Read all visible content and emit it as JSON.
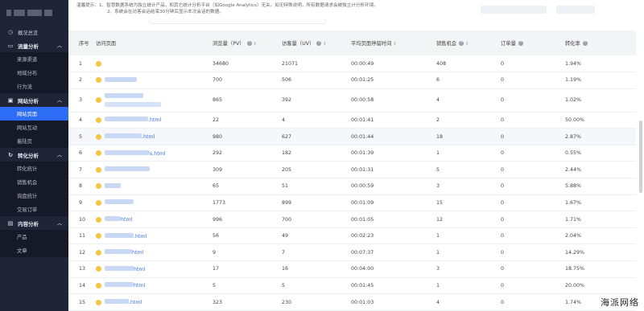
{
  "header": {
    "notice_line1": "温馨提示：1、智慧数据系统为独立统计产品，和其它统计分析平台（如Google Analytics）无关。如无特殊说明，所有数据请求会被独立计分析环境。",
    "notice_line2": "2、系统会在访客会话结束30分钟后显示本次会话的数据。"
  },
  "sidebar": {
    "items": [
      {
        "type": "item",
        "label": "概况总览",
        "icon": "dashboard-icon",
        "glyph": "◷"
      },
      {
        "type": "group",
        "label": "流量分析",
        "icon": "traffic-icon",
        "glyph": "▭"
      },
      {
        "type": "sub",
        "label": "来源渠道"
      },
      {
        "type": "sub",
        "label": "地域分布"
      },
      {
        "type": "sub",
        "label": "行为流"
      },
      {
        "type": "group",
        "label": "网站分析",
        "icon": "website-icon",
        "glyph": "▣"
      },
      {
        "type": "sub",
        "label": "网站页面",
        "active": true
      },
      {
        "type": "sub",
        "label": "网站互动"
      },
      {
        "type": "sub",
        "label": "着陆页"
      },
      {
        "type": "group",
        "label": "转化分析",
        "icon": "conversion-icon",
        "glyph": "↻"
      },
      {
        "type": "sub",
        "label": "转化统计"
      },
      {
        "type": "sub",
        "label": "销售机会"
      },
      {
        "type": "sub",
        "label": "询盘统计"
      },
      {
        "type": "sub",
        "label": "交易订单"
      },
      {
        "type": "group",
        "label": "内容分析",
        "icon": "content-icon",
        "glyph": "▤"
      },
      {
        "type": "sub",
        "label": "产品"
      },
      {
        "type": "sub",
        "label": "文章"
      }
    ]
  },
  "table": {
    "columns": {
      "idx": "序号",
      "page": "访问页面",
      "pv": "浏览量（PV）",
      "uv": "访客量（UV）",
      "avg_time": "平均页面停留时间",
      "leads": "销售机会",
      "orders": "订单量",
      "conv": "转化率"
    },
    "rows": [
      {
        "idx": "1",
        "page_text": "",
        "pv": "34680",
        "uv": "21071",
        "time": "00:00:49",
        "leads": "408",
        "orders": "0",
        "conv": "1.94%"
      },
      {
        "idx": "2",
        "page_text": "",
        "pv": "700",
        "uv": "506",
        "time": "00:01:25",
        "leads": "6",
        "orders": "0",
        "conv": "1.19%"
      },
      {
        "idx": "3",
        "page_text": "",
        "pv": "865",
        "uv": "392",
        "time": "00:00:58",
        "leads": "4",
        "orders": "0",
        "conv": "1.02%"
      },
      {
        "idx": "4",
        "page_text": ".html",
        "pv": "22",
        "uv": "4",
        "time": "00:01:41",
        "leads": "2",
        "orders": "0",
        "conv": "50.00%"
      },
      {
        "idx": "5",
        "page_text": ".html",
        "pv": "980",
        "uv": "627",
        "time": "00:01:44",
        "leads": "18",
        "orders": "0",
        "conv": "2.87%"
      },
      {
        "idx": "6",
        "page_text": "s.html",
        "pv": "292",
        "uv": "182",
        "time": "00:01:39",
        "leads": "1",
        "orders": "0",
        "conv": "0.55%"
      },
      {
        "idx": "7",
        "page_text": "",
        "pv": "309",
        "uv": "205",
        "time": "00:01:31",
        "leads": "5",
        "orders": "0",
        "conv": "2.44%"
      },
      {
        "idx": "8",
        "page_text": "",
        "pv": "65",
        "uv": "51",
        "time": "00:00:59",
        "leads": "3",
        "orders": "0",
        "conv": "5.88%"
      },
      {
        "idx": "9",
        "page_text": "",
        "pv": "1773",
        "uv": "899",
        "time": "00:01:09",
        "leads": "15",
        "orders": "0",
        "conv": "1.67%"
      },
      {
        "idx": "10",
        "page_text": "html",
        "pv": "996",
        "uv": "700",
        "time": "00:01:05",
        "leads": "12",
        "orders": "0",
        "conv": "1.71%"
      },
      {
        "idx": "11",
        "page_text": ".html",
        "pv": "56",
        "uv": "49",
        "time": "00:02:23",
        "leads": "1",
        "orders": "0",
        "conv": "2.04%"
      },
      {
        "idx": "12",
        "page_text": "html",
        "pv": "9",
        "uv": "7",
        "time": "00:07:37",
        "leads": "1",
        "orders": "0",
        "conv": "14.29%"
      },
      {
        "idx": "13",
        "page_text": "html",
        "pv": "17",
        "uv": "16",
        "time": "00:04:00",
        "leads": "3",
        "orders": "0",
        "conv": "18.75%"
      },
      {
        "idx": "14",
        "page_text": "html",
        "pv": "5",
        "uv": "5",
        "time": "00:01:45",
        "leads": "1",
        "orders": "0",
        "conv": "20.00%"
      },
      {
        "idx": "15",
        "page_text": ".html",
        "pv": "323",
        "uv": "230",
        "time": "00:01:03",
        "leads": "4",
        "orders": "0",
        "conv": "1.74%"
      }
    ]
  },
  "watermark": "海派网络",
  "colors": {
    "sidebar_bg": "#1f2437",
    "active_bg": "#2d6df6",
    "link": "#3b6fe0",
    "page_dot": "#f5c542"
  }
}
